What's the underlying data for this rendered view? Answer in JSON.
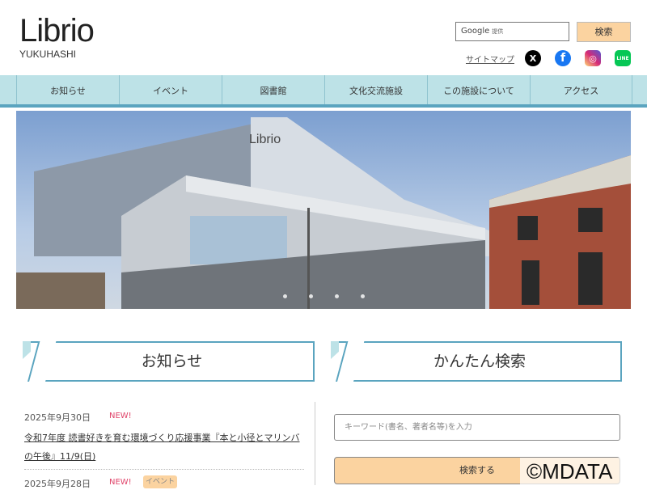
{
  "logo": {
    "main": "Librio",
    "sub": "YUKUHASHI"
  },
  "search": {
    "placeholder_brand": "Google",
    "placeholder_note": "提供",
    "button": "検索"
  },
  "header": {
    "sitemap": "サイトマップ",
    "sns": [
      {
        "name": "x",
        "label": "X",
        "color": "#000000"
      },
      {
        "name": "facebook",
        "label": "f",
        "color": "#1877f2"
      },
      {
        "name": "instagram",
        "label": "◎",
        "color": "#d62976"
      },
      {
        "name": "line",
        "label": "LINE",
        "color": "#06c755"
      }
    ]
  },
  "nav": [
    "お知らせ",
    "イベント",
    "図書館",
    "文化交流施設",
    "この施設について",
    "アクセス"
  ],
  "hero": {
    "slides": 4,
    "active": 0
  },
  "news": {
    "heading": "お知らせ",
    "items": [
      {
        "date": "2025年9月30日",
        "badge": "NEW!",
        "title": "令和7年度 読書好きを育む環境づくり応援事業『本と小径とマリンバの午後』11/9(日)"
      },
      {
        "date": "2025年9月28日",
        "badge": "NEW!",
        "tag": "イベント"
      }
    ]
  },
  "quick_search": {
    "heading": "かんたん検索",
    "placeholder": "キーワード(書名、著者名等)を入力",
    "button": "検索する"
  },
  "watermark": "©MDATA"
}
